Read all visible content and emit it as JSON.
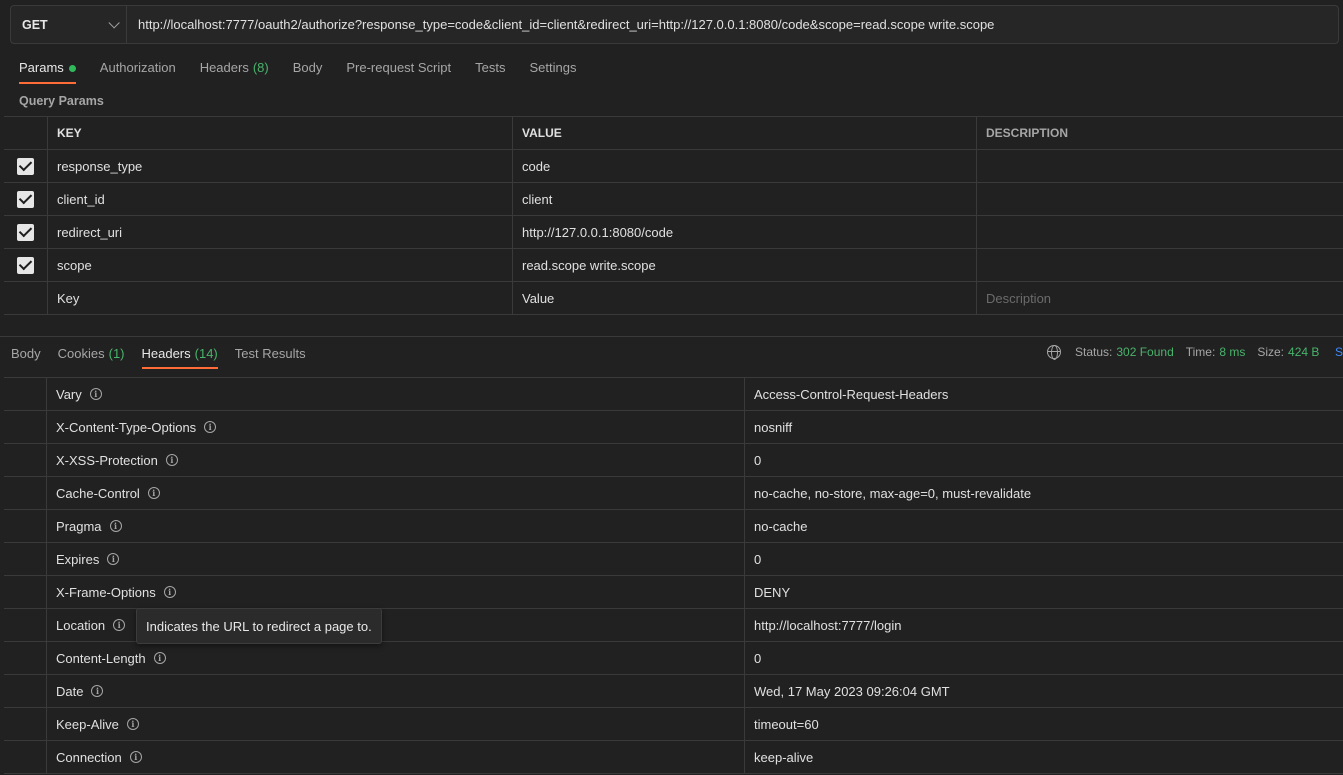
{
  "request": {
    "method": "GET",
    "url": "http://localhost:7777/oauth2/authorize?response_type=code&client_id=client&redirect_uri=http://127.0.0.1:8080/code&scope=read.scope write.scope"
  },
  "request_tabs": [
    {
      "label": "Params",
      "active": true
    },
    {
      "label": "Authorization",
      "count": ""
    },
    {
      "label": "Headers",
      "count": "(8)"
    },
    {
      "label": "Body"
    },
    {
      "label": "Pre-request Script"
    },
    {
      "label": "Tests"
    },
    {
      "label": "Settings"
    }
  ],
  "query_params": {
    "title": "Query Params",
    "headers": {
      "key": "KEY",
      "value": "VALUE",
      "description": "DESCRIPTION"
    },
    "rows": [
      {
        "key": "response_type",
        "value": "code",
        "description": ""
      },
      {
        "key": "client_id",
        "value": "client",
        "description": ""
      },
      {
        "key": "redirect_uri",
        "value": "http://127.0.0.1:8080/code",
        "description": ""
      },
      {
        "key": "scope",
        "value": "read.scope write.scope",
        "description": ""
      }
    ],
    "placeholders": {
      "key": "Key",
      "value": "Value",
      "description": "Description"
    }
  },
  "response_tabs": [
    {
      "label": "Body"
    },
    {
      "label": "Cookies",
      "count": "(1)"
    },
    {
      "label": "Headers",
      "count": "(14)",
      "active": true
    },
    {
      "label": "Test Results"
    }
  ],
  "status": {
    "status_label": "Status:",
    "status_value": "302 Found",
    "time_label": "Time:",
    "time_value": "8 ms",
    "size_label": "Size:",
    "size_value": "424 B",
    "save_label": "S"
  },
  "response_headers": [
    {
      "key": "Vary",
      "value": "Access-Control-Request-Headers"
    },
    {
      "key": "X-Content-Type-Options",
      "value": "nosniff"
    },
    {
      "key": "X-XSS-Protection",
      "value": "0"
    },
    {
      "key": "Cache-Control",
      "value": "no-cache, no-store, max-age=0, must-revalidate"
    },
    {
      "key": "Pragma",
      "value": "no-cache"
    },
    {
      "key": "Expires",
      "value": "0"
    },
    {
      "key": "X-Frame-Options",
      "value": "DENY"
    },
    {
      "key": "Location",
      "value": "http://localhost:7777/login"
    },
    {
      "key": "Content-Length",
      "value": "0"
    },
    {
      "key": "Date",
      "value": "Wed, 17 May 2023 09:26:04 GMT"
    },
    {
      "key": "Keep-Alive",
      "value": "timeout=60"
    },
    {
      "key": "Connection",
      "value": "keep-alive"
    }
  ],
  "tooltip": "Indicates the URL to redirect a page to.",
  "colors": {
    "accent": "#ff6c37",
    "success": "#49b36b",
    "link": "#3d8bff"
  }
}
